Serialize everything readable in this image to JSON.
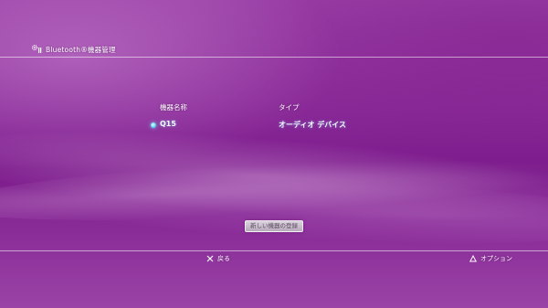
{
  "header": {
    "title": "Bluetooth®機器管理",
    "icon": "gear-bluetooth-icon"
  },
  "table": {
    "columns": {
      "name": "機器名称",
      "type": "タイプ"
    },
    "rows": [
      {
        "name": "Q15",
        "type": "オーディオ デバイス",
        "status_color": "#4fd8f0"
      }
    ]
  },
  "actions": {
    "register_label": "新しい機器の登録"
  },
  "footer": {
    "back_label": "戻る",
    "back_icon": "cross-icon",
    "option_label": "オプション",
    "option_icon": "triangle-icon"
  },
  "theme": {
    "background": "#8a2a98",
    "accent": "#4fd8f0"
  }
}
